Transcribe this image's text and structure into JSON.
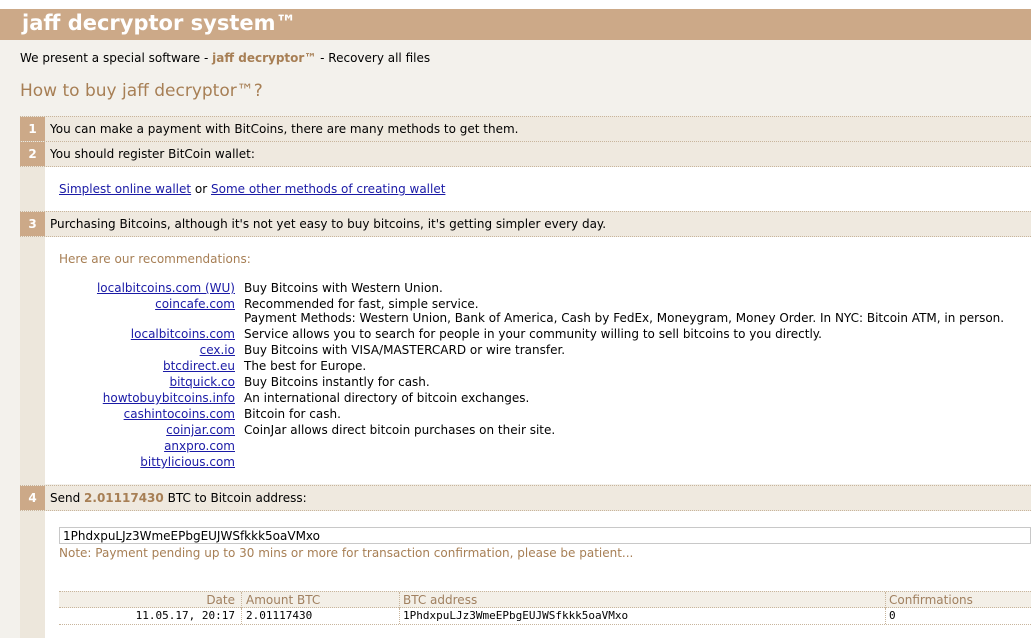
{
  "header": {
    "title": "jaff decryptor system™"
  },
  "intro": {
    "prefix": "We present a special software - ",
    "product": "jaff decryptor™",
    "suffix": " - Recovery all files"
  },
  "how_to_buy": "How to buy jaff decryptor™?",
  "steps": [
    {
      "num": "1",
      "text": "You can make a payment with BitCoins, there are many methods to get them."
    },
    {
      "num": "2",
      "text": "You should register BitCoin wallet:"
    },
    {
      "num": "3",
      "text": "Purchasing Bitcoins, although it's not yet easy to buy bitcoins, it's getting simpler every day."
    },
    {
      "num": "4",
      "text_prefix": "Send ",
      "amount": "2.01117430",
      "text_suffix": " BTC to Bitcoin address:"
    }
  ],
  "wallet": {
    "link1": "Simplest online wallet",
    "or": " or ",
    "link2": "Some other methods of creating wallet"
  },
  "recommendations_label": "Here are our recommendations:",
  "recommendations": [
    {
      "site": "localbitcoins.com (WU)",
      "desc": "Buy Bitcoins with Western Union."
    },
    {
      "site": "coincafe.com",
      "desc": "Recommended for fast, simple service."
    },
    {
      "site": "",
      "desc": "Payment Methods: Western Union, Bank of America, Cash by FedEx, Moneygram, Money Order. In NYC: Bitcoin ATM, in person."
    },
    {
      "site": "localbitcoins.com",
      "desc": "Service allows you to search for people in your community willing to sell bitcoins to you directly."
    },
    {
      "site": "cex.io",
      "desc": "Buy Bitcoins with VISA/MASTERCARD or wire transfer."
    },
    {
      "site": "btcdirect.eu",
      "desc": "The best for Europe."
    },
    {
      "site": "bitquick.co",
      "desc": "Buy Bitcoins instantly for cash."
    },
    {
      "site": "howtobuybitcoins.info",
      "desc": "An international directory of bitcoin exchanges."
    },
    {
      "site": "cashintocoins.com",
      "desc": "Bitcoin for cash."
    },
    {
      "site": "coinjar.com",
      "desc": "CoinJar allows direct bitcoin purchases on their site."
    },
    {
      "site": "anxpro.com",
      "desc": ""
    },
    {
      "site": "bittylicious.com",
      "desc": ""
    }
  ],
  "address": "1PhdxpuLJz3WmeEPbgEUJWSfkkk5oaVMxo",
  "note": "Note: Payment pending up to 30 mins or more for transaction confirmation, please be patient...",
  "table": {
    "headers": {
      "date": "Date",
      "amount": "Amount BTC",
      "address": "BTC address",
      "confirmations": "Confirmations"
    },
    "row": {
      "date": "11.05.17, 20:17",
      "amount": "2.01117430",
      "address": "1PhdxpuLJz3WmeEPbgEUJWSfkkk5oaVMxo",
      "confirmations": "0"
    }
  },
  "colors": {
    "accent": "#cca988",
    "accent_text": "#a77f55",
    "link": "#1a1aa6"
  }
}
